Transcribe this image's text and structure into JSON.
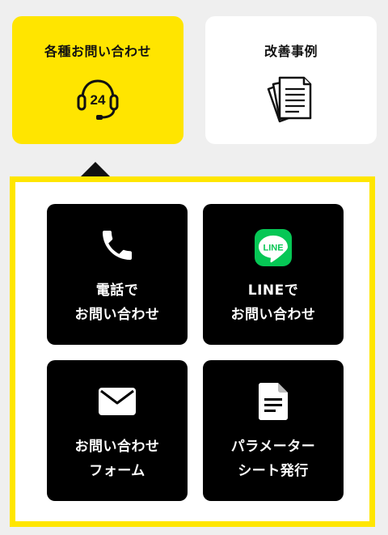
{
  "tabs": [
    {
      "label": "各種お問い合わせ",
      "icon": "headset-24-icon",
      "active": true,
      "color": "#ffe500"
    },
    {
      "label": "改善事例",
      "icon": "documents-icon",
      "active": false,
      "color": "#ffffff"
    }
  ],
  "panel": {
    "border_color": "#ffe600",
    "cards": [
      {
        "line1": "電話で",
        "line2": "お問い合わせ",
        "icon": "phone-icon"
      },
      {
        "line1": "LINEで",
        "line2": "お問い合わせ",
        "icon": "line-icon",
        "icon_text": "LINE",
        "icon_color": "#06c755"
      },
      {
        "line1": "お問い合わせ",
        "line2": "フォーム",
        "icon": "mail-icon"
      },
      {
        "line1": "パラメーター",
        "line2": "シート発行",
        "icon": "document-icon"
      }
    ]
  },
  "headset_badge": "24"
}
